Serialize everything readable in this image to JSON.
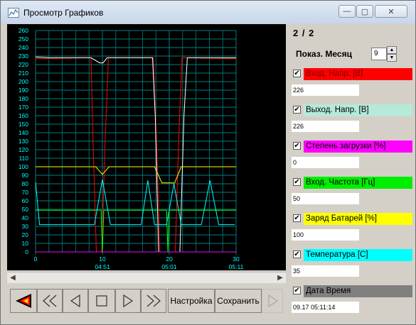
{
  "window": {
    "title": "Просмотр Графиков",
    "minimize_glyph": "—",
    "maximize_glyph": "▢",
    "close_glyph": "✕"
  },
  "side": {
    "page_indicator": "2 / 2",
    "months_label": "Показ. Месяц",
    "months_value": "9",
    "series": [
      {
        "label": "Вход. Напр. [В]",
        "value": "226",
        "color": "#ff0000",
        "text_color": "#7a0000",
        "checked": true
      },
      {
        "label": "Выход. Напр. [В]",
        "value": "226",
        "color": "#b5e9d9",
        "text_color": "#000000",
        "checked": true
      },
      {
        "label": "Степень загрузки [%]",
        "value": "0",
        "color": "#ff00ff",
        "text_color": "#000000",
        "checked": true
      },
      {
        "label": "Вход. Частота [Гц]",
        "value": "50",
        "color": "#00ee00",
        "text_color": "#000000",
        "checked": true
      },
      {
        "label": "Заряд Батарей [%]",
        "value": "100",
        "color": "#ffff00",
        "text_color": "#000000",
        "checked": true
      },
      {
        "label": "Температура [С]",
        "value": "35",
        "color": "#00ffff",
        "text_color": "#000000",
        "checked": true
      },
      {
        "label": "Дата Время",
        "value": "09.17 05:11:14",
        "color": "#808080",
        "text_color": "#000000",
        "checked": true
      }
    ]
  },
  "controls": {
    "settings_label": "Настройка",
    "save_label": "Сохранить"
  },
  "chart_data": {
    "type": "line",
    "ylim": [
      0,
      260
    ],
    "yticks": [
      "0",
      "10",
      "20",
      "30",
      "40",
      "50",
      "60",
      "70",
      "80",
      "90",
      "100",
      "110",
      "120",
      "130",
      "140",
      "150",
      "160",
      "170",
      "180",
      "190",
      "200",
      "210",
      "220",
      "230",
      "240",
      "250",
      "260"
    ],
    "xlim": [
      0,
      30
    ],
    "xticks": [
      {
        "x": 0,
        "label": "0",
        "sublabel": ""
      },
      {
        "x": 10,
        "label": "10",
        "sublabel": "04:51"
      },
      {
        "x": 20,
        "label": "20",
        "sublabel": "05:01"
      },
      {
        "x": 30,
        "label": "30",
        "sublabel": "05:11"
      }
    ],
    "grid": true,
    "background": "#000000",
    "grid_color": "#008080",
    "series": [
      {
        "color": "#ff0000",
        "points": [
          [
            0,
            227
          ],
          [
            8.3,
            228
          ],
          [
            8.6,
            130
          ],
          [
            9.1,
            0
          ],
          [
            9.9,
            0
          ],
          [
            10.4,
            130
          ],
          [
            10.9,
            228
          ],
          [
            17.6,
            228
          ],
          [
            18.1,
            130
          ],
          [
            18.6,
            0
          ],
          [
            20.9,
            0
          ],
          [
            21.4,
            130
          ],
          [
            21.9,
            228
          ],
          [
            30,
            227
          ]
        ]
      },
      {
        "color": "#ffffff",
        "points": [
          [
            0,
            229
          ],
          [
            2,
            228
          ],
          [
            5,
            228
          ],
          [
            8.3,
            228
          ],
          [
            9.6,
            222
          ],
          [
            10.1,
            222
          ],
          [
            10.7,
            228
          ],
          [
            17.5,
            228
          ],
          [
            17.9,
            160
          ],
          [
            18.4,
            0
          ],
          [
            21.6,
            0
          ],
          [
            22.2,
            160
          ],
          [
            22.7,
            228
          ],
          [
            30,
            228
          ]
        ]
      },
      {
        "color": "#ff00ff",
        "points": [
          [
            0,
            0
          ],
          [
            30,
            0
          ]
        ]
      },
      {
        "color": "#00ff00",
        "points": [
          [
            0,
            49
          ],
          [
            9.8,
            49
          ],
          [
            10,
            0
          ],
          [
            10.2,
            49
          ],
          [
            19.6,
            49
          ],
          [
            19.8,
            0
          ],
          [
            20,
            49
          ],
          [
            30,
            49
          ]
        ]
      },
      {
        "color": "#ffff00",
        "points": [
          [
            0,
            100
          ],
          [
            9,
            100
          ],
          [
            10,
            91
          ],
          [
            11,
            100
          ],
          [
            17.8,
            100
          ],
          [
            18.9,
            81
          ],
          [
            20.8,
            81
          ],
          [
            21.8,
            100
          ],
          [
            30,
            100
          ]
        ]
      },
      {
        "color": "#00ffff",
        "points": [
          [
            0,
            82
          ],
          [
            0.6,
            32
          ],
          [
            8.8,
            32
          ],
          [
            10,
            85
          ],
          [
            11.2,
            32
          ],
          [
            15.8,
            32
          ],
          [
            16.8,
            84
          ],
          [
            17.8,
            32
          ],
          [
            19.6,
            32
          ],
          [
            20.7,
            80
          ],
          [
            21.8,
            32
          ],
          [
            24.8,
            32
          ],
          [
            26.1,
            84
          ],
          [
            27.4,
            32
          ],
          [
            29.8,
            32
          ]
        ]
      }
    ]
  }
}
